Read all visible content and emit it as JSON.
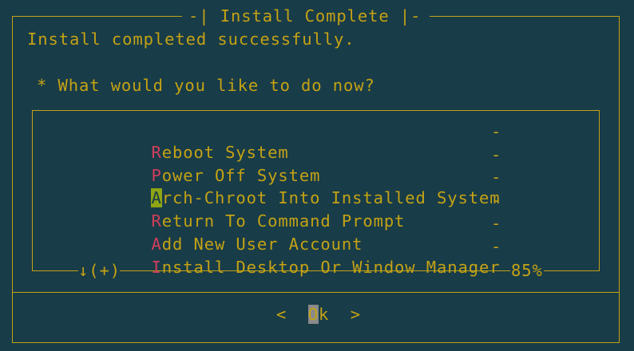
{
  "dialog": {
    "title": "-| Install Complete |-",
    "message": "Install completed successfully.",
    "question": "* What would you like to do now?"
  },
  "menu": {
    "items": [
      {
        "hotkey": "R",
        "rest": "eboot System",
        "suffix": "-",
        "selected": false
      },
      {
        "hotkey": "P",
        "rest": "ower Off System",
        "suffix": "-",
        "selected": false
      },
      {
        "hotkey": "A",
        "rest": "rch-Chroot Into Installed System",
        "suffix": "-",
        "selected": true
      },
      {
        "hotkey": "R",
        "rest": "eturn To Command Prompt",
        "suffix": "-",
        "selected": false
      },
      {
        "hotkey": "A",
        "rest": "dd New User Account",
        "suffix": "-",
        "selected": false
      },
      {
        "hotkey": "I",
        "rest": "nstall Desktop Or Window Manager",
        "suffix": "-",
        "selected": false
      }
    ],
    "scroll_indicator": "↓(+)",
    "scroll_percent": "85%"
  },
  "buttons": {
    "left_arrow": "<",
    "ok_first": "O",
    "ok_rest": "k",
    "right_arrow": ">"
  },
  "colors": {
    "background": "#183c48",
    "text": "#c4a215",
    "hotkey": "#d23e5c",
    "selected_hotkey_bg": "#8fa514",
    "button_focus_bg": "#8a8a8a"
  }
}
